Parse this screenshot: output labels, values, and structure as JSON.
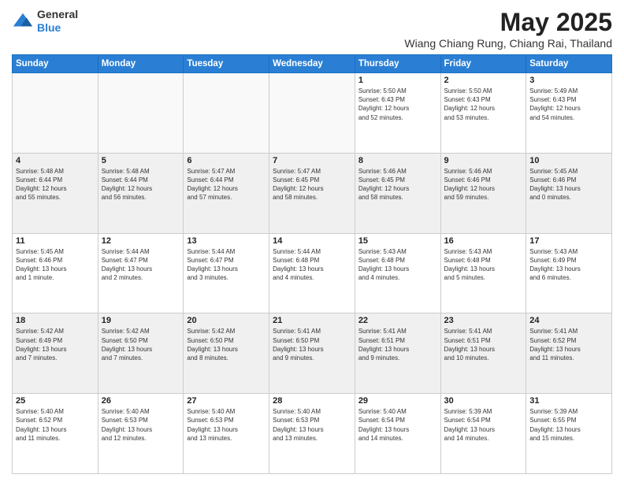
{
  "header": {
    "logo_general": "General",
    "logo_blue": "Blue",
    "month_year": "May 2025",
    "location": "Wiang Chiang Rung, Chiang Rai, Thailand"
  },
  "days_of_week": [
    "Sunday",
    "Monday",
    "Tuesday",
    "Wednesday",
    "Thursday",
    "Friday",
    "Saturday"
  ],
  "weeks": [
    [
      {
        "day": "",
        "info": ""
      },
      {
        "day": "",
        "info": ""
      },
      {
        "day": "",
        "info": ""
      },
      {
        "day": "",
        "info": ""
      },
      {
        "day": "1",
        "info": "Sunrise: 5:50 AM\nSunset: 6:43 PM\nDaylight: 12 hours\nand 52 minutes."
      },
      {
        "day": "2",
        "info": "Sunrise: 5:50 AM\nSunset: 6:43 PM\nDaylight: 12 hours\nand 53 minutes."
      },
      {
        "day": "3",
        "info": "Sunrise: 5:49 AM\nSunset: 6:43 PM\nDaylight: 12 hours\nand 54 minutes."
      }
    ],
    [
      {
        "day": "4",
        "info": "Sunrise: 5:48 AM\nSunset: 6:44 PM\nDaylight: 12 hours\nand 55 minutes."
      },
      {
        "day": "5",
        "info": "Sunrise: 5:48 AM\nSunset: 6:44 PM\nDaylight: 12 hours\nand 56 minutes."
      },
      {
        "day": "6",
        "info": "Sunrise: 5:47 AM\nSunset: 6:44 PM\nDaylight: 12 hours\nand 57 minutes."
      },
      {
        "day": "7",
        "info": "Sunrise: 5:47 AM\nSunset: 6:45 PM\nDaylight: 12 hours\nand 58 minutes."
      },
      {
        "day": "8",
        "info": "Sunrise: 5:46 AM\nSunset: 6:45 PM\nDaylight: 12 hours\nand 58 minutes."
      },
      {
        "day": "9",
        "info": "Sunrise: 5:46 AM\nSunset: 6:46 PM\nDaylight: 12 hours\nand 59 minutes."
      },
      {
        "day": "10",
        "info": "Sunrise: 5:45 AM\nSunset: 6:46 PM\nDaylight: 13 hours\nand 0 minutes."
      }
    ],
    [
      {
        "day": "11",
        "info": "Sunrise: 5:45 AM\nSunset: 6:46 PM\nDaylight: 13 hours\nand 1 minute."
      },
      {
        "day": "12",
        "info": "Sunrise: 5:44 AM\nSunset: 6:47 PM\nDaylight: 13 hours\nand 2 minutes."
      },
      {
        "day": "13",
        "info": "Sunrise: 5:44 AM\nSunset: 6:47 PM\nDaylight: 13 hours\nand 3 minutes."
      },
      {
        "day": "14",
        "info": "Sunrise: 5:44 AM\nSunset: 6:48 PM\nDaylight: 13 hours\nand 4 minutes."
      },
      {
        "day": "15",
        "info": "Sunrise: 5:43 AM\nSunset: 6:48 PM\nDaylight: 13 hours\nand 4 minutes."
      },
      {
        "day": "16",
        "info": "Sunrise: 5:43 AM\nSunset: 6:48 PM\nDaylight: 13 hours\nand 5 minutes."
      },
      {
        "day": "17",
        "info": "Sunrise: 5:43 AM\nSunset: 6:49 PM\nDaylight: 13 hours\nand 6 minutes."
      }
    ],
    [
      {
        "day": "18",
        "info": "Sunrise: 5:42 AM\nSunset: 6:49 PM\nDaylight: 13 hours\nand 7 minutes."
      },
      {
        "day": "19",
        "info": "Sunrise: 5:42 AM\nSunset: 6:50 PM\nDaylight: 13 hours\nand 7 minutes."
      },
      {
        "day": "20",
        "info": "Sunrise: 5:42 AM\nSunset: 6:50 PM\nDaylight: 13 hours\nand 8 minutes."
      },
      {
        "day": "21",
        "info": "Sunrise: 5:41 AM\nSunset: 6:50 PM\nDaylight: 13 hours\nand 9 minutes."
      },
      {
        "day": "22",
        "info": "Sunrise: 5:41 AM\nSunset: 6:51 PM\nDaylight: 13 hours\nand 9 minutes."
      },
      {
        "day": "23",
        "info": "Sunrise: 5:41 AM\nSunset: 6:51 PM\nDaylight: 13 hours\nand 10 minutes."
      },
      {
        "day": "24",
        "info": "Sunrise: 5:41 AM\nSunset: 6:52 PM\nDaylight: 13 hours\nand 11 minutes."
      }
    ],
    [
      {
        "day": "25",
        "info": "Sunrise: 5:40 AM\nSunset: 6:52 PM\nDaylight: 13 hours\nand 11 minutes."
      },
      {
        "day": "26",
        "info": "Sunrise: 5:40 AM\nSunset: 6:53 PM\nDaylight: 13 hours\nand 12 minutes."
      },
      {
        "day": "27",
        "info": "Sunrise: 5:40 AM\nSunset: 6:53 PM\nDaylight: 13 hours\nand 13 minutes."
      },
      {
        "day": "28",
        "info": "Sunrise: 5:40 AM\nSunset: 6:53 PM\nDaylight: 13 hours\nand 13 minutes."
      },
      {
        "day": "29",
        "info": "Sunrise: 5:40 AM\nSunset: 6:54 PM\nDaylight: 13 hours\nand 14 minutes."
      },
      {
        "day": "30",
        "info": "Sunrise: 5:39 AM\nSunset: 6:54 PM\nDaylight: 13 hours\nand 14 minutes."
      },
      {
        "day": "31",
        "info": "Sunrise: 5:39 AM\nSunset: 6:55 PM\nDaylight: 13 hours\nand 15 minutes."
      }
    ]
  ]
}
